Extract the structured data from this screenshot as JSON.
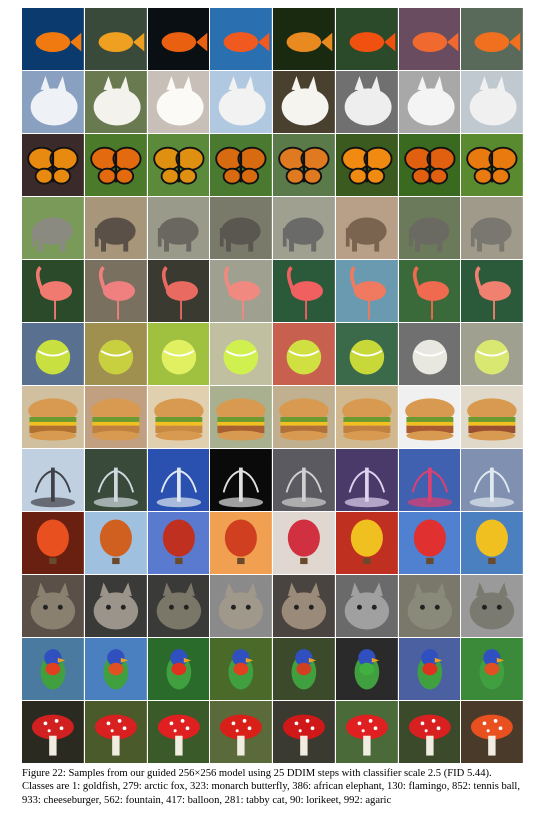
{
  "figure": {
    "caption_line1": "Figure 22: Samples from our guided 256×256 model using 25 DDIM steps with classifier scale 2.5",
    "caption_line2": "(FID 5.44). Classes are 1: goldfish, 279: arctic fox, 323: monarch butterfly, 386: african elephant,",
    "caption_line3": "130: flamingo, 852: tennis ball, 933: cheeseburger, 562: fountain, 417: balloon, 281: tabby cat, 90:",
    "caption_line4": "lorikeet, 992: agaric"
  },
  "grid": {
    "columns": 8,
    "rows": [
      {
        "subject": "goldfish",
        "palettes": [
          [
            "#0b3a6e",
            "#f07a10"
          ],
          [
            "#3a4a3a",
            "#f0a020"
          ],
          [
            "#0a0f14",
            "#e86010"
          ],
          [
            "#2a6fb0",
            "#f05a20"
          ],
          [
            "#1a2a10",
            "#e88a20"
          ],
          [
            "#2a4a2a",
            "#f05010"
          ],
          [
            "#6a4c60",
            "#f06a30"
          ],
          [
            "#5a6a5a",
            "#f07020"
          ]
        ]
      },
      {
        "subject": "arctic fox",
        "palettes": [
          [
            "#8aa0c0",
            "#eef2f6"
          ],
          [
            "#6a7a50",
            "#f4f2ec"
          ],
          [
            "#c8c0b8",
            "#fbfaf6"
          ],
          [
            "#b0c8e0",
            "#f2f2f2"
          ],
          [
            "#4a4030",
            "#f6f4ee"
          ],
          [
            "#707070",
            "#eeeeee"
          ],
          [
            "#a8a8a8",
            "#f4f4f4"
          ],
          [
            "#c0c8d0",
            "#f0f0f0"
          ]
        ]
      },
      {
        "subject": "monarch butterfly",
        "palettes": [
          [
            "#3a2a2a",
            "#e88a10"
          ],
          [
            "#4a7a2a",
            "#e46a10"
          ],
          [
            "#5a8a3a",
            "#e09010"
          ],
          [
            "#4a7a30",
            "#d86a10"
          ],
          [
            "#5a7a4a",
            "#e07a20"
          ],
          [
            "#3a5a20",
            "#f08a10"
          ],
          [
            "#3a6a20",
            "#e06010"
          ],
          [
            "#5a8a30",
            "#e87a10"
          ]
        ]
      },
      {
        "subject": "african elephant",
        "palettes": [
          [
            "#7a9a5a",
            "#8a8a80"
          ],
          [
            "#a8967a",
            "#5a5048"
          ],
          [
            "#9a9a8a",
            "#6a6660"
          ],
          [
            "#7a7a6a",
            "#5a5650"
          ],
          [
            "#a0a090",
            "#6a6a68"
          ],
          [
            "#b8a088",
            "#7a6450"
          ],
          [
            "#6a7a5a",
            "#6a6a62"
          ],
          [
            "#a09a8a",
            "#7a7670"
          ]
        ]
      },
      {
        "subject": "flamingo",
        "palettes": [
          [
            "#2a4a2a",
            "#f07a70"
          ],
          [
            "#7a7060",
            "#f08080"
          ],
          [
            "#3a3a30",
            "#e86a60"
          ],
          [
            "#a0a090",
            "#f08a80"
          ],
          [
            "#2a5a3a",
            "#f06060"
          ],
          [
            "#6a9ab0",
            "#f07a60"
          ],
          [
            "#3a6a3a",
            "#f06a50"
          ],
          [
            "#2a5a3a",
            "#f08070"
          ]
        ]
      },
      {
        "subject": "tennis ball",
        "palettes": [
          [
            "#5a7090",
            "#c8e040"
          ],
          [
            "#a09050",
            "#c8d040"
          ],
          [
            "#a0c040",
            "#e0f060"
          ],
          [
            "#c0c0a0",
            "#d0f050"
          ],
          [
            "#c86050",
            "#d0e040"
          ],
          [
            "#3a6a4a",
            "#c8d838"
          ],
          [
            "#707070",
            "#e8e8e0"
          ],
          [
            "#a0a090",
            "#d8e870"
          ]
        ]
      },
      {
        "subject": "cheeseburger",
        "palettes": [
          [
            "#d0c0a0",
            "#b07030"
          ],
          [
            "#c0a080",
            "#c08040"
          ],
          [
            "#e0d0b0",
            "#c88a40"
          ],
          [
            "#a8b090",
            "#a86030"
          ],
          [
            "#c0b090",
            "#b07038"
          ],
          [
            "#d0b890",
            "#c08040"
          ],
          [
            "#f0f0f0",
            "#a85a30"
          ],
          [
            "#e0d8c8",
            "#9a5030"
          ]
        ]
      },
      {
        "subject": "fountain",
        "palettes": [
          [
            "#c0d0e0",
            "#404048"
          ],
          [
            "#3a4a3a",
            "#d0d8e0"
          ],
          [
            "#2a50b0",
            "#e0e8f0"
          ],
          [
            "#0a0a0a",
            "#e0e0e0"
          ],
          [
            "#5a5a60",
            "#d0d0d0"
          ],
          [
            "#4a3a6a",
            "#e0d0f0"
          ],
          [
            "#4060b0",
            "#e04070"
          ],
          [
            "#8090b0",
            "#e0e8f0"
          ]
        ]
      },
      {
        "subject": "balloon",
        "palettes": [
          [
            "#6a2010",
            "#e85020"
          ],
          [
            "#a0c0e0",
            "#d06020"
          ],
          [
            "#5a7ad0",
            "#c03020"
          ],
          [
            "#f0a050",
            "#d04020"
          ],
          [
            "#e0d8d0",
            "#d03040"
          ],
          [
            "#c03020",
            "#f0c020"
          ],
          [
            "#5080d0",
            "#e03030"
          ],
          [
            "#4a80c0",
            "#f0c020"
          ]
        ]
      },
      {
        "subject": "tabby cat",
        "palettes": [
          [
            "#5a5048",
            "#8a8070"
          ],
          [
            "#3a3a38",
            "#9a948a"
          ],
          [
            "#3a3a38",
            "#7a7668"
          ],
          [
            "#8a8a8a",
            "#a0988a"
          ],
          [
            "#4a4440",
            "#9a8a7a"
          ],
          [
            "#6a6a6a",
            "#a0a0a0"
          ],
          [
            "#7a786a",
            "#8a8a7a"
          ],
          [
            "#9a9a9a",
            "#7a7a70"
          ]
        ]
      },
      {
        "subject": "lorikeet",
        "palettes": [
          [
            "#4a7aa0",
            "#e04020"
          ],
          [
            "#4a80c0",
            "#e05020"
          ],
          [
            "#2a6a2a",
            "#e03020"
          ],
          [
            "#4a6a2a",
            "#e04020"
          ],
          [
            "#3a4a2a",
            "#d04020"
          ],
          [
            "#2a2a2a",
            "#40b040"
          ],
          [
            "#4a60a0",
            "#e03020"
          ],
          [
            "#3a8a3a",
            "#e05020"
          ]
        ]
      },
      {
        "subject": "agaric",
        "palettes": [
          [
            "#2a2a20",
            "#d02020"
          ],
          [
            "#4a5a2a",
            "#d82020"
          ],
          [
            "#3a5a2a",
            "#e02020"
          ],
          [
            "#5a6a3a",
            "#d82018"
          ],
          [
            "#3a3a30",
            "#d01818"
          ],
          [
            "#4a6a3a",
            "#e02020"
          ],
          [
            "#3a4a2a",
            "#d82020"
          ],
          [
            "#4a3a2a",
            "#e85020"
          ]
        ]
      }
    ]
  }
}
